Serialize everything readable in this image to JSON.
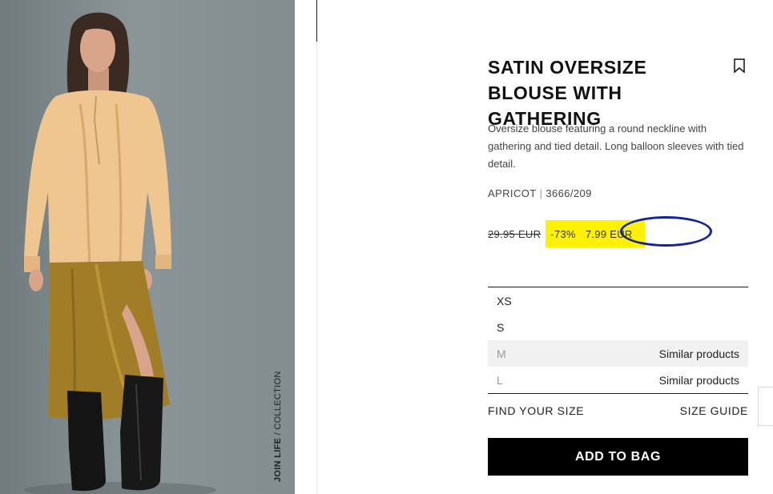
{
  "image": {
    "caption_bold": "JOIN LIFE",
    "caption_rest": " / COLLECTION"
  },
  "product": {
    "title": "SATIN OVERSIZE BLOUSE WITH GATHERING",
    "description": "Oversize blouse featuring a round neckline with gathering and tied detail. Long balloon sleeves with tied detail.",
    "color": "APRICOT",
    "ref_separator": "|",
    "reference": "3666/209",
    "old_price": "29.95 EUR",
    "discount": "-73%",
    "price": "7.99 EUR",
    "bookmark_icon": "bookmark-icon"
  },
  "sizes": [
    {
      "name": "XS",
      "note": "",
      "state": "available"
    },
    {
      "name": "S",
      "note": "",
      "state": "available"
    },
    {
      "name": "M",
      "note": "Similar products",
      "state": "unavailable"
    },
    {
      "name": "L",
      "note": "Similar products",
      "state": "muted"
    }
  ],
  "links": {
    "find_size": "FIND YOUR SIZE",
    "size_guide": "SIZE GUIDE"
  },
  "actions": {
    "add_to_bag": "ADD TO BAG"
  },
  "colors": {
    "price_highlight": "#fef200",
    "annotation_circle": "#122496",
    "button_bg": "#000000"
  }
}
